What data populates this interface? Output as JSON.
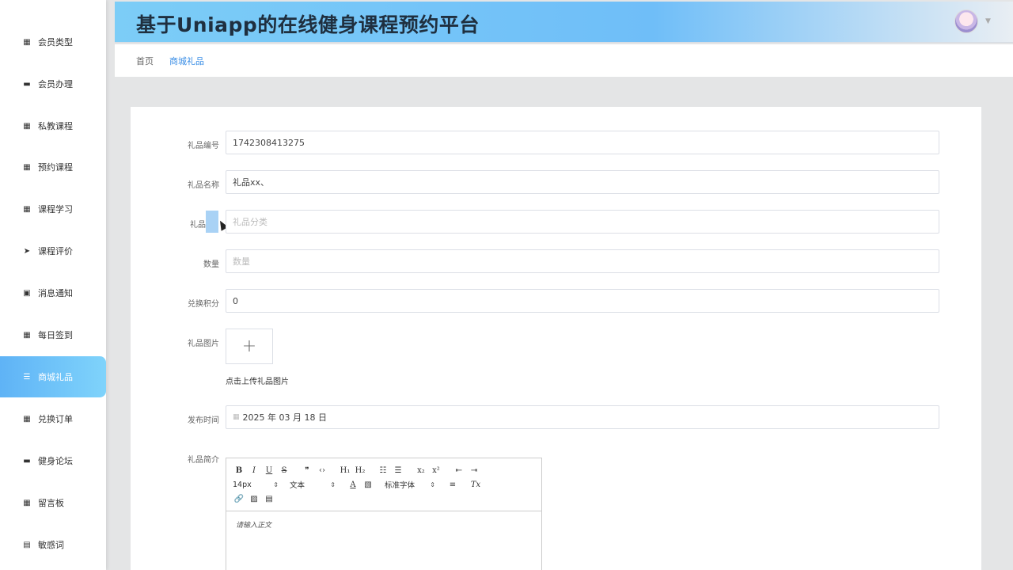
{
  "app_title": "基于Uniapp的在线健身课程预约平台",
  "sidebar": {
    "items": [
      {
        "label": "会员类型",
        "icon": "grid-icon"
      },
      {
        "label": "会员办理",
        "icon": "card-icon"
      },
      {
        "label": "私教课程",
        "icon": "grid-icon"
      },
      {
        "label": "预约课程",
        "icon": "grid-icon"
      },
      {
        "label": "课程学习",
        "icon": "grid-icon"
      },
      {
        "label": "课程评价",
        "icon": "send-icon"
      },
      {
        "label": "消息通知",
        "icon": "clipboard-icon"
      },
      {
        "label": "每日签到",
        "icon": "grid-icon"
      },
      {
        "label": "商城礼品",
        "icon": "list-icon"
      },
      {
        "label": "兑换订单",
        "icon": "grid-icon"
      },
      {
        "label": "健身论坛",
        "icon": "monitor-icon"
      },
      {
        "label": "留言板",
        "icon": "grid-icon"
      },
      {
        "label": "敏感词",
        "icon": "file-icon"
      }
    ],
    "active_index": 8
  },
  "breadcrumb": {
    "home": "首页",
    "current": "商城礼品"
  },
  "form": {
    "gift_no": {
      "label": "礼品编号",
      "value": "1742308413275"
    },
    "gift_name": {
      "label": "礼品名称",
      "value": "礼品xx、"
    },
    "gift_category": {
      "label": "礼品",
      "placeholder": "礼品分类"
    },
    "quantity": {
      "label": "数量",
      "placeholder": "数量"
    },
    "points": {
      "label": "兑换积分",
      "value": "0"
    },
    "image": {
      "label": "礼品图片",
      "plus": "+",
      "hint": "点击上传礼品图片"
    },
    "publish_time": {
      "label": "发布时间",
      "value": "2025 年 03 月 18 日"
    },
    "intro": {
      "label": "礼品简介",
      "font_size": "14px",
      "text_type": "文本",
      "font_family": "标准字体",
      "placeholder": "请输入正文"
    }
  },
  "colors": {
    "accent": "#3a8ee6",
    "sidebar_active_start": "#5fb3f6",
    "sidebar_active_end": "#7fd3fb",
    "header_start": "#7ccdf7"
  }
}
